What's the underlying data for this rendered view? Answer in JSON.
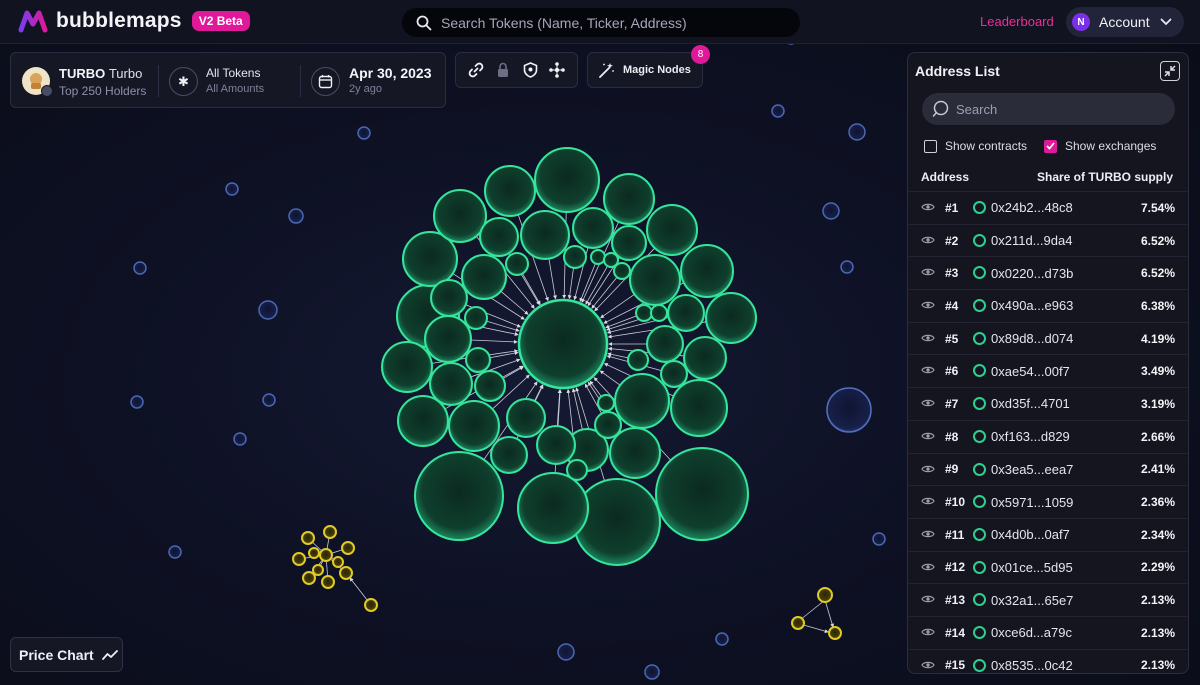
{
  "brand": {
    "name": "bubblemaps",
    "badge": "V2 Beta"
  },
  "top_search": {
    "placeholder": "Search Tokens (Name, Ticker, Address)"
  },
  "nav": {
    "leaderboard": "Leaderboard",
    "account_initial": "N",
    "account_label": "Account"
  },
  "token": {
    "symbol": "TURBO",
    "name": "Turbo",
    "holders_label": "Top 250 Holders",
    "filter_title": "All Tokens",
    "filter_sub": "All Amounts",
    "date": "Apr 30, 2023",
    "date_ago": "2y ago"
  },
  "toolbar": {
    "icons": [
      "link-icon",
      "lock-icon",
      "shield-icon",
      "network-icon"
    ]
  },
  "magic_nodes": {
    "label": "Magic Nodes",
    "count": "8"
  },
  "address_list": {
    "title": "Address List",
    "search_placeholder": "Search",
    "show_contracts": {
      "label": "Show contracts",
      "checked": false
    },
    "show_exchanges": {
      "label": "Show exchanges",
      "checked": true
    },
    "col_address": "Address",
    "col_share": "Share of TURBO supply",
    "rows": [
      {
        "rank": "#1",
        "address": "0x24b2...48c8",
        "share": "7.54%"
      },
      {
        "rank": "#2",
        "address": "0x211d...9da4",
        "share": "6.52%"
      },
      {
        "rank": "#3",
        "address": "0x0220...d73b",
        "share": "6.52%"
      },
      {
        "rank": "#4",
        "address": "0x490a...e963",
        "share": "6.38%"
      },
      {
        "rank": "#5",
        "address": "0x89d8...d074",
        "share": "4.19%"
      },
      {
        "rank": "#6",
        "address": "0xae54...00f7",
        "share": "3.49%"
      },
      {
        "rank": "#7",
        "address": "0xd35f...4701",
        "share": "3.19%"
      },
      {
        "rank": "#8",
        "address": "0xf163...d829",
        "share": "2.66%"
      },
      {
        "rank": "#9",
        "address": "0x3ea5...eea7",
        "share": "2.41%"
      },
      {
        "rank": "#10",
        "address": "0x5971...1059",
        "share": "2.36%"
      },
      {
        "rank": "#11",
        "address": "0x4d0b...0af7",
        "share": "2.34%"
      },
      {
        "rank": "#12",
        "address": "0x01ce...5d95",
        "share": "2.29%"
      },
      {
        "rank": "#13",
        "address": "0x32a1...65e7",
        "share": "2.13%"
      },
      {
        "rank": "#14",
        "address": "0xce6d...a79c",
        "share": "2.13%"
      },
      {
        "rank": "#15",
        "address": "0x8535...0c42",
        "share": "2.13%"
      }
    ]
  },
  "price_chart": {
    "label": "Price Chart"
  },
  "colors": {
    "accent": "#e0199a",
    "bubble_green": "#2fd08f",
    "bubble_yellow": "#d6c21e",
    "bubble_blue": "#3c5aa0"
  }
}
